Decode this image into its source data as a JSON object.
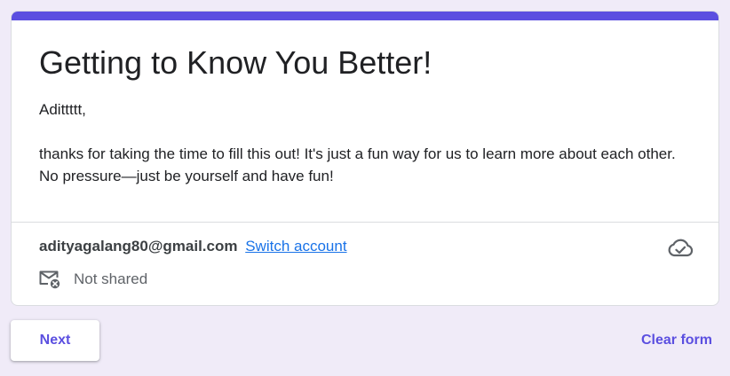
{
  "form": {
    "title": "Getting to Know You Better!",
    "description": {
      "greeting": "Adittttt,",
      "body": "thanks for taking the time to fill this out! It's just a fun way for us to learn more about each other. No pressure—just be yourself and have fun!"
    }
  },
  "account": {
    "email": "adityagalang80@gmail.com",
    "switch_label": "Switch account",
    "saved_icon": "cloud-check-icon",
    "sharing_icon": "mail-not-shared-icon",
    "sharing_status": "Not shared"
  },
  "actions": {
    "next_label": "Next",
    "clear_label": "Clear form"
  },
  "colors": {
    "accent": "#5b4fe0",
    "background": "#f0ebf8",
    "link": "#1a73e8",
    "text": "#202124",
    "muted_text": "#5f6368"
  }
}
